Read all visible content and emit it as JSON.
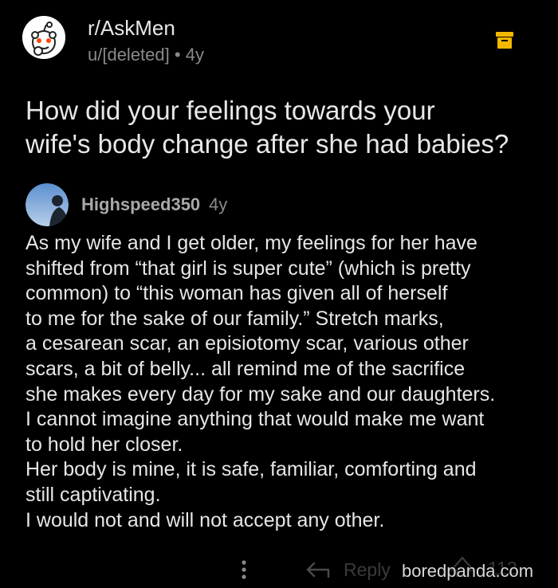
{
  "post": {
    "subreddit": "r/AskMen",
    "author": "u/[deleted]",
    "separator": "•",
    "age": "4y",
    "title_lines": [
      "How did your feelings towards your",
      "wife's body change after she had babies?"
    ]
  },
  "comment": {
    "author": "Highspeed350",
    "age": "4y",
    "body_lines": [
      "As my wife and I get older, my feelings for her have",
      "shifted from “that girl is super cute” (which is pretty",
      "common) to “this woman has given all of herself",
      "to me for the sake of our family.”  Stretch marks,",
      "a cesarean scar, an episiotomy scar, various other",
      "scars, a bit of belly...  all remind me of the sacrifice",
      "she makes every day for my sake and our daughters.",
      "I cannot imagine anything that would make me want",
      "to hold her closer.",
      "Her body is mine, it is safe, familiar, comforting and",
      "still captivating.",
      "I would not and will not accept any other."
    ]
  },
  "actions": {
    "reply_label": "Reply",
    "vote_count": "112",
    "more_icon": "more-vertical-icon",
    "reply_icon": "reply-arrow-icon",
    "upvote_icon": "upvote-arrow-icon"
  },
  "icons": {
    "archive_icon": "archive-box-icon",
    "subreddit_avatar": "reddit-snoo-icon"
  },
  "watermark": "boredpanda.com",
  "colors": {
    "background": "#000000",
    "archive_accent": "#f5b800",
    "primary_text": "#e6e6e6",
    "meta_text": "#8a8a8a"
  }
}
